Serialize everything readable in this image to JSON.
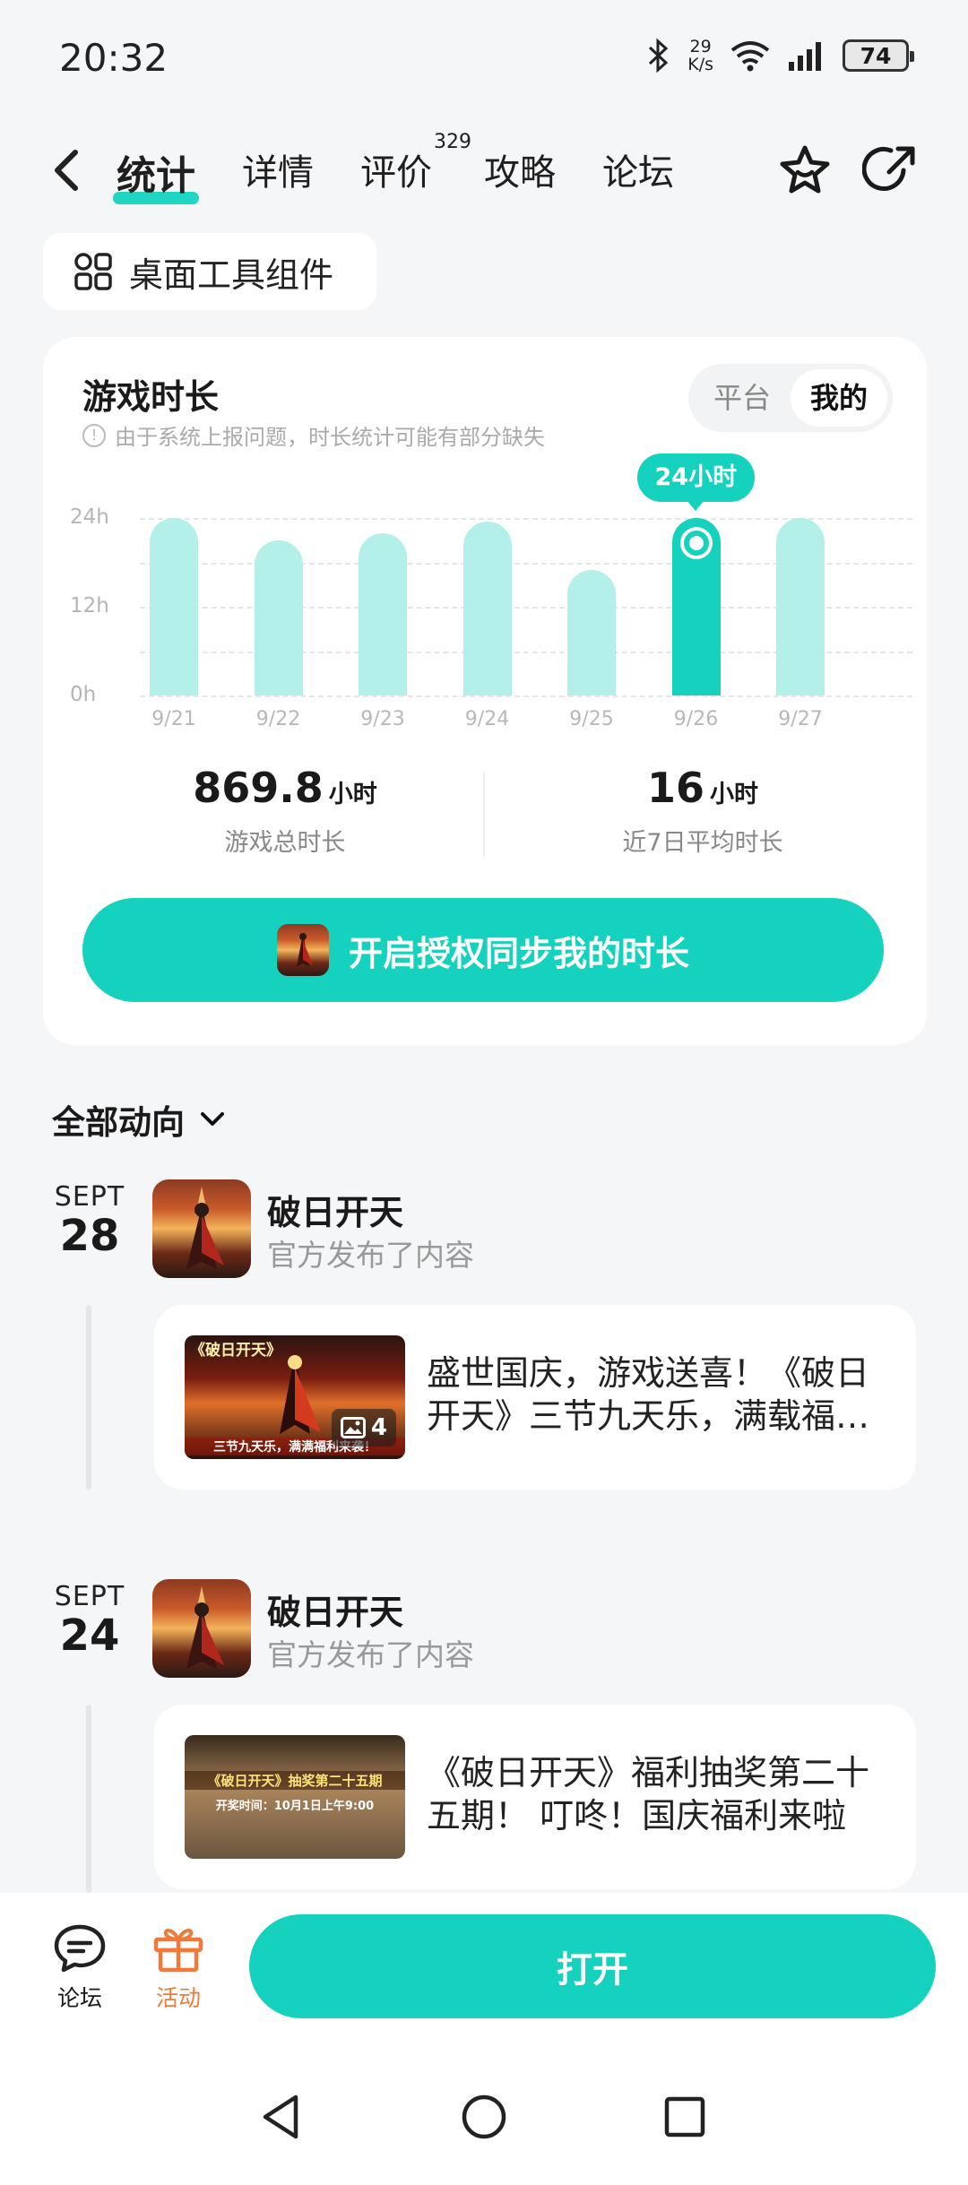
{
  "status_bar": {
    "time": "20:32",
    "net_speed_value": "29",
    "net_speed_unit": "K/s",
    "battery": "74"
  },
  "nav": {
    "tabs": [
      {
        "label": "统计",
        "active": true
      },
      {
        "label": "详情"
      },
      {
        "label": "评价",
        "badge": "329"
      },
      {
        "label": "攻略"
      },
      {
        "label": "论坛"
      }
    ]
  },
  "widget_chip": {
    "label": "桌面工具组件"
  },
  "stats": {
    "title": "游戏时长",
    "note": "由于系统上报问题，时长统计可能有部分缺失",
    "toggle": [
      "平台",
      "我的"
    ],
    "toggle_selected": "我的",
    "tooltip": "24小时",
    "total_value": "869.8",
    "total_unit": "小时",
    "total_label": "游戏总时长",
    "avg_value": "16",
    "avg_unit": "小时",
    "avg_label": "近7日平均时长",
    "auth_button": "开启授权同步我的时长"
  },
  "chart_data": {
    "type": "bar",
    "categories": [
      "9/21",
      "9/22",
      "9/23",
      "9/24",
      "9/25",
      "9/26",
      "9/27"
    ],
    "values": [
      24,
      21,
      22,
      23.5,
      17,
      24,
      24
    ],
    "highlight_index": 5,
    "yticks": [
      "24h",
      "12h",
      "0h"
    ],
    "ylim": [
      0,
      24
    ],
    "colors": {
      "bar": "#b4f0ea",
      "highlight": "#14d2bd"
    }
  },
  "feed": {
    "header": "全部动向",
    "items": [
      {
        "month": "SEPT",
        "day": "28",
        "name": "破日开天",
        "sub": "官方发布了内容",
        "post_text": "盛世国庆，游戏送喜！《破日开天》三节九天乐，满载福利来袭！",
        "image_count": "4",
        "img_caption_top": "《破日开天》",
        "img_caption_bottom": "三节九天乐，满满福利来袭！"
      },
      {
        "month": "SEPT",
        "day": "24",
        "name": "破日开天",
        "sub": "官方发布了内容",
        "post_text": "《破日开天》福利抽奖第二十五期！ 叮咚！国庆福利来啦",
        "img_caption_top": "《破日开天》抽奖第二十五期",
        "img_caption_bottom": "开奖时间：10月1日上午9:00"
      }
    ]
  },
  "bottom_bar": {
    "forum": "论坛",
    "activity": "活动",
    "open": "打开"
  }
}
